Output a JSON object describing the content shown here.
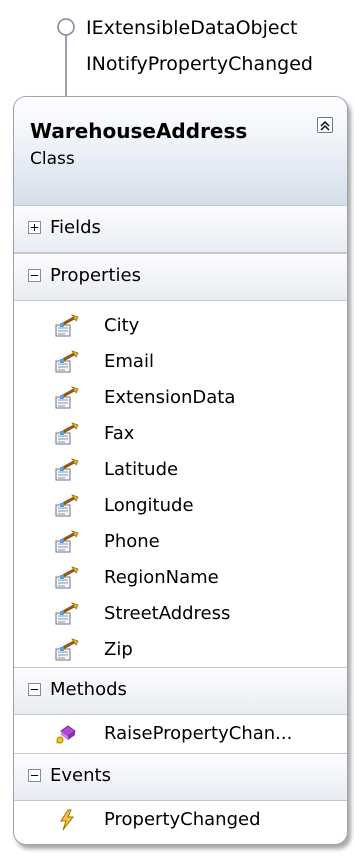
{
  "interfaces": [
    "IExtensibleDataObject",
    "INotifyPropertyChanged"
  ],
  "class_name": "WarehouseAddress",
  "stereotype": "Class",
  "sections": {
    "fields": {
      "label": "Fields"
    },
    "properties": {
      "label": "Properties",
      "items": [
        "City",
        "Email",
        "ExtensionData",
        "Fax",
        "Latitude",
        "Longitude",
        "Phone",
        "RegionName",
        "StreetAddress",
        "Zip"
      ]
    },
    "methods": {
      "label": "Methods",
      "items": [
        "RaisePropertyChan..."
      ]
    },
    "events": {
      "label": "Events",
      "items": [
        "PropertyChanged"
      ]
    }
  }
}
